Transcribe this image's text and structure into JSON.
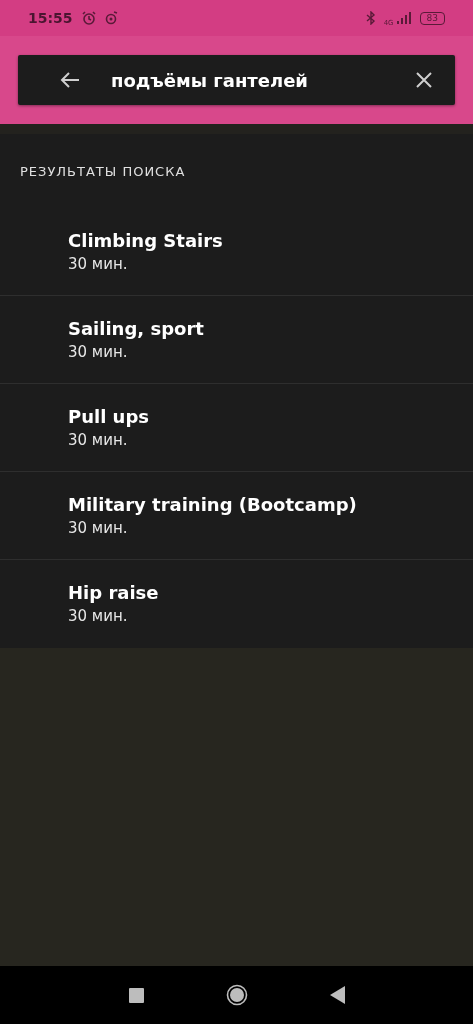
{
  "status_bar": {
    "time": "15:55",
    "network": "4G",
    "battery": "83"
  },
  "search": {
    "value": "подъёмы гантелей"
  },
  "results": {
    "heading": "РЕЗУЛЬТАТЫ ПОИСКА",
    "items": [
      {
        "title": "Climbing Stairs",
        "duration": "30 мин."
      },
      {
        "title": "Sailing, sport",
        "duration": "30 мин."
      },
      {
        "title": "Pull ups",
        "duration": "30 мин."
      },
      {
        "title": "Military training (Bootcamp)",
        "duration": "30 мин."
      },
      {
        "title": "Hip raise",
        "duration": "30 мин."
      }
    ]
  }
}
